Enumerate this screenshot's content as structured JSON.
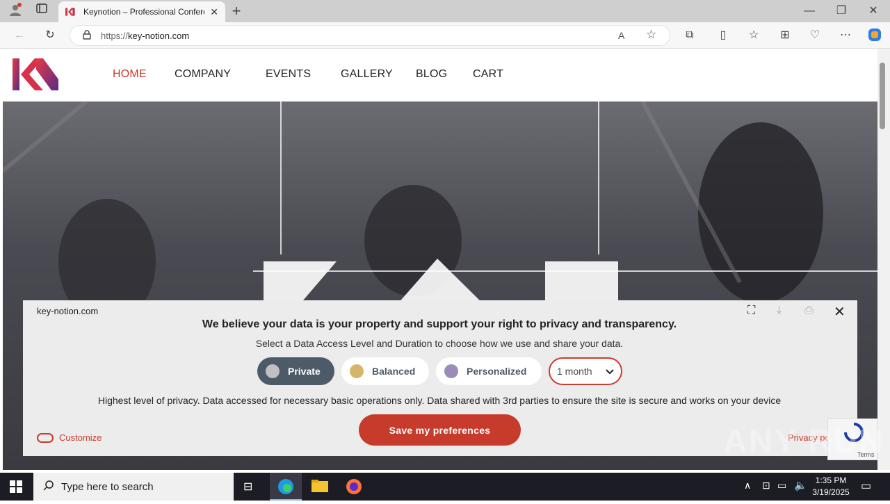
{
  "browser": {
    "tab_title": "Keynotion – Professional Confere",
    "url_prefix": "https://",
    "url_domain": "key-notion.com",
    "new_tab": "+"
  },
  "site": {
    "nav": [
      "HOME",
      "COMPANY",
      "EVENTS",
      "GALLERY",
      "BLOG",
      "CART"
    ],
    "active_nav": "HOME",
    "accent": "#c63b2b"
  },
  "consent": {
    "domain": "key-notion.com",
    "title": "We believe your data is your property and support your right to privacy and transparency.",
    "subtitle": "Select a Data Access Level and Duration to choose how we use and share your data.",
    "levels": [
      {
        "label": "Private",
        "selected": true,
        "dot": "#bfbfc4"
      },
      {
        "label": "Balanced",
        "selected": false,
        "dot": "#d6b56a"
      },
      {
        "label": "Personalized",
        "selected": false,
        "dot": "#9a8bb8"
      }
    ],
    "duration": "1 month",
    "description": "Highest level of privacy. Data accessed for necessary basic operations only. Data shared with 3rd parties to ensure the site is secure and works on your device",
    "save_label": "Save my preferences",
    "customize_label": "Customize",
    "privacy_label": "Privacy policy",
    "recaptcha_terms": "Terms"
  },
  "taskbar": {
    "search_placeholder": "Type here to search",
    "time": "1:35 PM",
    "date": "3/19/2025"
  },
  "watermark": "ANY RUN"
}
